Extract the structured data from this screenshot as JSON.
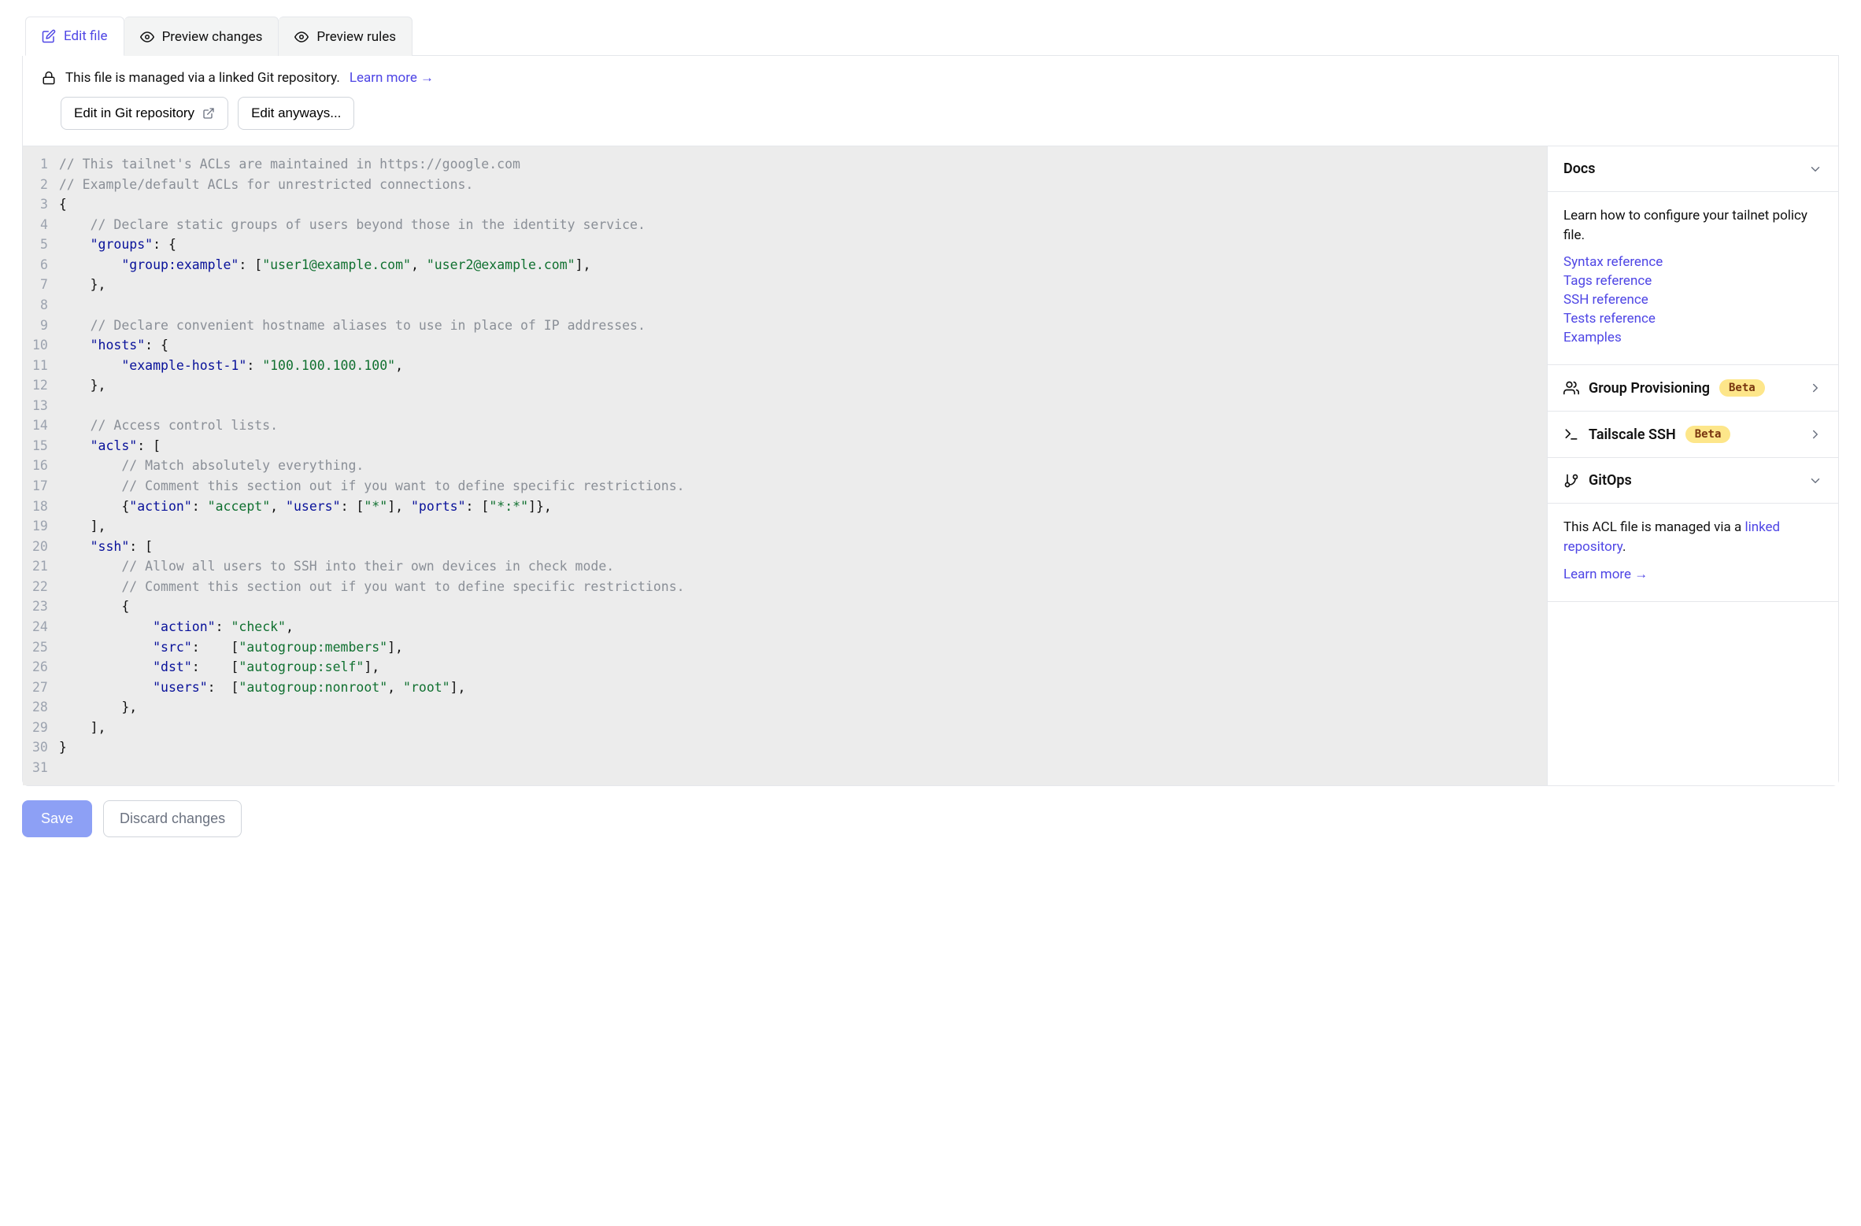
{
  "tabs": {
    "edit": "Edit file",
    "preview_changes": "Preview changes",
    "preview_rules": "Preview rules"
  },
  "banner": {
    "message": "This file is managed via a linked Git repository.",
    "learn_more": "Learn more →",
    "edit_repo": "Edit in Git repository",
    "edit_anyways": "Edit anyways..."
  },
  "editor": {
    "lines": [
      [
        [
          "comment",
          "// This tailnet's ACLs are maintained in https://google.com"
        ]
      ],
      [
        [
          "comment",
          "// Example/default ACLs for unrestricted connections."
        ]
      ],
      [
        [
          "punc",
          "{"
        ]
      ],
      [
        [
          "indent",
          1
        ],
        [
          "comment",
          "// Declare static groups of users beyond those in the identity service."
        ]
      ],
      [
        [
          "indent",
          1
        ],
        [
          "key",
          "\"groups\""
        ],
        [
          "punc",
          ": {"
        ]
      ],
      [
        [
          "indent",
          2
        ],
        [
          "key",
          "\"group:example\""
        ],
        [
          "punc",
          ": ["
        ],
        [
          "str",
          "\"user1@example.com\""
        ],
        [
          "punc",
          ", "
        ],
        [
          "str",
          "\"user2@example.com\""
        ],
        [
          "punc",
          "],"
        ]
      ],
      [
        [
          "indent",
          1
        ],
        [
          "punc",
          "},"
        ]
      ],
      [],
      [
        [
          "indent",
          1
        ],
        [
          "comment",
          "// Declare convenient hostname aliases to use in place of IP addresses."
        ]
      ],
      [
        [
          "indent",
          1
        ],
        [
          "key",
          "\"hosts\""
        ],
        [
          "punc",
          ": {"
        ]
      ],
      [
        [
          "indent",
          2
        ],
        [
          "key",
          "\"example-host-1\""
        ],
        [
          "punc",
          ": "
        ],
        [
          "str",
          "\"100.100.100.100\""
        ],
        [
          "punc",
          ","
        ]
      ],
      [
        [
          "indent",
          1
        ],
        [
          "punc",
          "},"
        ]
      ],
      [],
      [
        [
          "indent",
          1
        ],
        [
          "comment",
          "// Access control lists."
        ]
      ],
      [
        [
          "indent",
          1
        ],
        [
          "key",
          "\"acls\""
        ],
        [
          "punc",
          ": ["
        ]
      ],
      [
        [
          "indent",
          2
        ],
        [
          "comment",
          "// Match absolutely everything."
        ]
      ],
      [
        [
          "indent",
          2
        ],
        [
          "comment",
          "// Comment this section out if you want to define specific restrictions."
        ]
      ],
      [
        [
          "indent",
          2
        ],
        [
          "punc",
          "{"
        ],
        [
          "key",
          "\"action\""
        ],
        [
          "punc",
          ": "
        ],
        [
          "str",
          "\"accept\""
        ],
        [
          "punc",
          ", "
        ],
        [
          "key",
          "\"users\""
        ],
        [
          "punc",
          ": ["
        ],
        [
          "str",
          "\"*\""
        ],
        [
          "punc",
          "], "
        ],
        [
          "key",
          "\"ports\""
        ],
        [
          "punc",
          ": ["
        ],
        [
          "str",
          "\"*:*\""
        ],
        [
          "punc",
          "]},"
        ]
      ],
      [
        [
          "indent",
          1
        ],
        [
          "punc",
          "],"
        ]
      ],
      [
        [
          "indent",
          1
        ],
        [
          "key",
          "\"ssh\""
        ],
        [
          "punc",
          ": ["
        ]
      ],
      [
        [
          "indent",
          2
        ],
        [
          "comment",
          "// Allow all users to SSH into their own devices in check mode."
        ]
      ],
      [
        [
          "indent",
          2
        ],
        [
          "comment",
          "// Comment this section out if you want to define specific restrictions."
        ]
      ],
      [
        [
          "indent",
          2
        ],
        [
          "punc",
          "{"
        ]
      ],
      [
        [
          "indent",
          3
        ],
        [
          "key",
          "\"action\""
        ],
        [
          "punc",
          ": "
        ],
        [
          "str",
          "\"check\""
        ],
        [
          "punc",
          ","
        ]
      ],
      [
        [
          "indent",
          3
        ],
        [
          "key",
          "\"src\""
        ],
        [
          "punc",
          ":    ["
        ],
        [
          "str",
          "\"autogroup:members\""
        ],
        [
          "punc",
          "],"
        ]
      ],
      [
        [
          "indent",
          3
        ],
        [
          "key",
          "\"dst\""
        ],
        [
          "punc",
          ":    ["
        ],
        [
          "str",
          "\"autogroup:self\""
        ],
        [
          "punc",
          "],"
        ]
      ],
      [
        [
          "indent",
          3
        ],
        [
          "key",
          "\"users\""
        ],
        [
          "punc",
          ":  ["
        ],
        [
          "str",
          "\"autogroup:nonroot\""
        ],
        [
          "punc",
          ", "
        ],
        [
          "str",
          "\"root\""
        ],
        [
          "punc",
          "],"
        ]
      ],
      [
        [
          "indent",
          2
        ],
        [
          "punc",
          "},"
        ]
      ],
      [
        [
          "indent",
          1
        ],
        [
          "punc",
          "],"
        ]
      ],
      [
        [
          "punc",
          "}"
        ]
      ],
      []
    ]
  },
  "sidebar": {
    "docs": {
      "title": "Docs",
      "intro": "Learn how to configure your tailnet policy file.",
      "links": {
        "syntax": "Syntax reference",
        "tags": "Tags reference",
        "ssh": "SSH reference",
        "tests": "Tests reference",
        "examples": "Examples"
      }
    },
    "group_prov": {
      "title": "Group Provisioning",
      "badge": "Beta"
    },
    "ts_ssh": {
      "title": "Tailscale SSH",
      "badge": "Beta"
    },
    "gitops": {
      "title": "GitOps",
      "body_prefix": "This ACL file is managed via a ",
      "body_link": "linked repository",
      "body_suffix": ".",
      "learn_more": "Learn more →"
    }
  },
  "footer": {
    "save": "Save",
    "discard": "Discard changes"
  }
}
